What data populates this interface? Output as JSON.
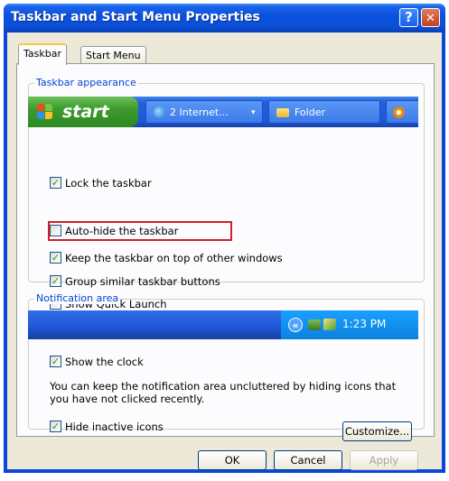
{
  "window": {
    "title": "Taskbar and Start Menu Properties",
    "help_glyph": "?",
    "close_glyph": "✕"
  },
  "tabs": [
    {
      "label": "Taskbar",
      "active": true
    },
    {
      "label": "Start Menu",
      "active": false
    }
  ],
  "taskbar_appearance": {
    "legend": "Taskbar appearance",
    "preview": {
      "start_label": "start",
      "item1_label": "2 Internet...",
      "item1_arrow": "▾",
      "item2_label": "Folder"
    },
    "options": [
      {
        "label": "Lock the taskbar",
        "checked": true
      },
      {
        "label": "Auto-hide the taskbar",
        "checked": false,
        "highlighted": true
      },
      {
        "label": "Keep the taskbar on top of other windows",
        "checked": true
      },
      {
        "label": "Group similar taskbar buttons",
        "checked": true
      },
      {
        "label": "Show Quick Launch",
        "checked": false
      }
    ]
  },
  "notification_area": {
    "legend": "Notification area",
    "preview": {
      "chevron": "«",
      "clock": "1:23 PM"
    },
    "show_clock": {
      "label": "Show the clock",
      "checked": true
    },
    "description": "You can keep the notification area uncluttered by hiding icons that you have not clicked recently.",
    "hide_inactive": {
      "label": "Hide inactive icons",
      "checked": true
    },
    "customize_label": "Customize..."
  },
  "footer": {
    "ok_label": "OK",
    "cancel_label": "Cancel",
    "apply_label": "Apply"
  },
  "colors": {
    "title_blue": "#0a52de",
    "highlight_red": "#d31f2a",
    "legend_blue": "#0046d5",
    "check_green": "#21a121"
  },
  "icons": [
    "help-icon",
    "close-icon",
    "windows-flag-icon",
    "internet-explorer-icon",
    "folder-icon",
    "media-player-icon",
    "chevron-left-icon",
    "network-icon",
    "tray-app-icon"
  ]
}
